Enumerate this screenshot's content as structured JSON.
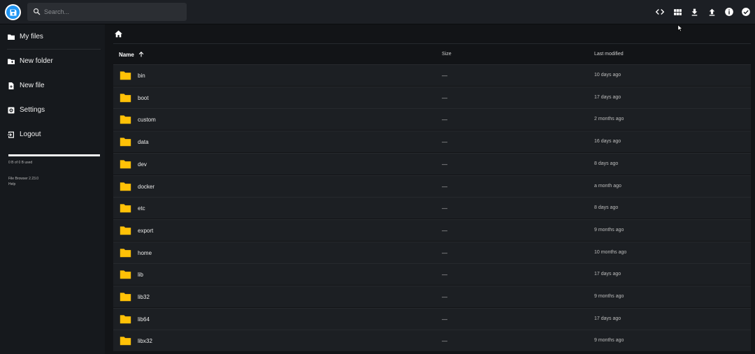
{
  "search": {
    "placeholder": "Search..."
  },
  "header": {
    "actions": [
      {
        "icon": "code-icon",
        "label": "Toggle view code"
      },
      {
        "icon": "grid-view-icon",
        "label": "Switch view"
      },
      {
        "icon": "download-icon",
        "label": "Download"
      },
      {
        "icon": "upload-icon",
        "label": "Upload"
      },
      {
        "icon": "info-icon",
        "label": "Info"
      },
      {
        "icon": "check-circle-icon",
        "label": "Select multiple"
      }
    ]
  },
  "sidebar": {
    "items": [
      {
        "label": "My files",
        "icon": "folder-icon"
      },
      {
        "label": "New folder",
        "icon": "new-folder-icon"
      },
      {
        "label": "New file",
        "icon": "new-file-icon"
      },
      {
        "label": "Settings",
        "icon": "settings-icon"
      },
      {
        "label": "Logout",
        "icon": "logout-icon"
      }
    ],
    "usage": "0 B of 0 B used",
    "version": "File Browser 2.23.0",
    "help": "Help"
  },
  "list": {
    "headers": {
      "name": "Name",
      "size": "Size",
      "modified": "Last modified"
    },
    "rows": [
      {
        "name": "bin",
        "size": "—",
        "modified": "10 days ago"
      },
      {
        "name": "boot",
        "size": "—",
        "modified": "17 days ago"
      },
      {
        "name": "custom",
        "size": "—",
        "modified": "2 months ago"
      },
      {
        "name": "data",
        "size": "—",
        "modified": "16 days ago"
      },
      {
        "name": "dev",
        "size": "—",
        "modified": "8 days ago"
      },
      {
        "name": "docker",
        "size": "—",
        "modified": "a month ago"
      },
      {
        "name": "etc",
        "size": "—",
        "modified": "8 days ago"
      },
      {
        "name": "export",
        "size": "—",
        "modified": "9 months ago"
      },
      {
        "name": "home",
        "size": "—",
        "modified": "10 months ago"
      },
      {
        "name": "lib",
        "size": "—",
        "modified": "17 days ago"
      },
      {
        "name": "lib32",
        "size": "—",
        "modified": "9 months ago"
      },
      {
        "name": "lib64",
        "size": "—",
        "modified": "17 days ago"
      },
      {
        "name": "libx32",
        "size": "—",
        "modified": "9 months ago"
      }
    ]
  },
  "colors": {
    "folder": "#ffc107",
    "accent": "#2196f3",
    "background": "#121417"
  }
}
